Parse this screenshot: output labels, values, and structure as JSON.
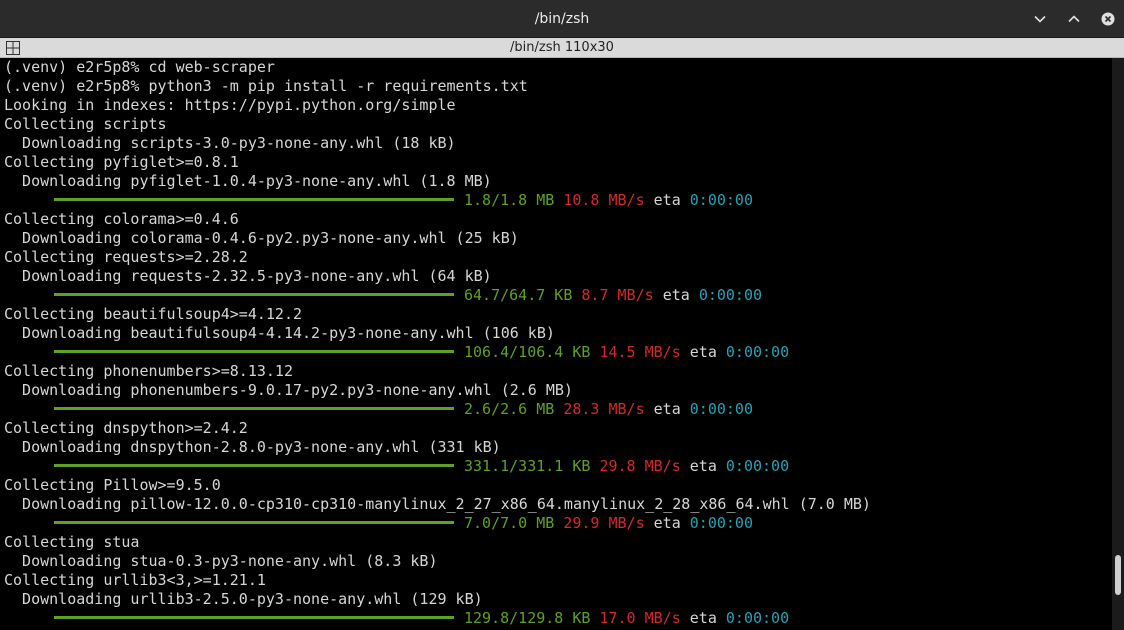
{
  "window": {
    "title": "/bin/zsh",
    "tab_label": "/bin/zsh 110x30",
    "icons": {
      "minimize": "chevron-down-icon",
      "maximize": "chevron-up-icon",
      "close": "close-icon",
      "new_tab": "new-tab-icon"
    }
  },
  "colors": {
    "progress_done": "#5fa02a",
    "speed": "#d22b2b",
    "eta": "#2aa1b3",
    "text": "#d6d6d6"
  },
  "terminal": {
    "lines": [
      "(.venv) e2r5p8% cd web-scraper",
      "(.venv) e2r5p8% python3 -m pip install -r requirements.txt",
      "Looking in indexes: https://pypi.python.org/simple",
      "Collecting scripts",
      "  Downloading scripts-3.0-py3-none-any.whl (18 kB)",
      "Collecting pyfiglet>=0.8.1",
      "  Downloading pyfiglet-1.0.4-py3-none-any.whl (1.8 MB)",
      "Collecting colorama>=0.4.6",
      "  Downloading colorama-0.4.6-py2.py3-none-any.whl (25 kB)",
      "Collecting requests>=2.28.2",
      "  Downloading requests-2.32.5-py3-none-any.whl (64 kB)",
      "Collecting beautifulsoup4>=4.12.2",
      "  Downloading beautifulsoup4-4.14.2-py3-none-any.whl (106 kB)",
      "Collecting phonenumbers>=8.13.12",
      "  Downloading phonenumbers-9.0.17-py2.py3-none-any.whl (2.6 MB)",
      "Collecting dnspython>=2.4.2",
      "  Downloading dnspython-2.8.0-py3-none-any.whl (331 kB)",
      "Collecting Pillow>=9.5.0",
      "  Downloading pillow-12.0.0-cp310-cp310-manylinux_2_27_x86_64.manylinux_2_28_x86_64.whl (7.0 MB)",
      "Collecting stua",
      "  Downloading stua-0.3-py3-none-any.whl (8.3 kB)",
      "Collecting urllib3<3,>=1.21.1",
      "  Downloading urllib3-2.5.0-py3-none-any.whl (129 kB)"
    ],
    "progress": [
      {
        "amount": "1.8/1.8 MB",
        "speed": "10.8 MB/s",
        "eta_label": "eta",
        "eta": "0:00:00",
        "fraction": 1.0
      },
      {
        "amount": "64.7/64.7 KB",
        "speed": "8.7 MB/s",
        "eta_label": "eta",
        "eta": "0:00:00",
        "fraction": 1.0
      },
      {
        "amount": "106.4/106.4 KB",
        "speed": "14.5 MB/s",
        "eta_label": "eta",
        "eta": "0:00:00",
        "fraction": 1.0
      },
      {
        "amount": "2.6/2.6 MB",
        "speed": "28.3 MB/s",
        "eta_label": "eta",
        "eta": "0:00:00",
        "fraction": 1.0
      },
      {
        "amount": "331.1/331.1 KB",
        "speed": "29.8 MB/s",
        "eta_label": "eta",
        "eta": "0:00:00",
        "fraction": 1.0
      },
      {
        "amount": "7.0/7.0 MB",
        "speed": "29.9 MB/s",
        "eta_label": "eta",
        "eta": "0:00:00",
        "fraction": 1.0
      },
      {
        "amount": "129.8/129.8 KB",
        "speed": "17.0 MB/s",
        "eta_label": "eta",
        "eta": "0:00:00",
        "fraction": 1.0
      }
    ]
  }
}
